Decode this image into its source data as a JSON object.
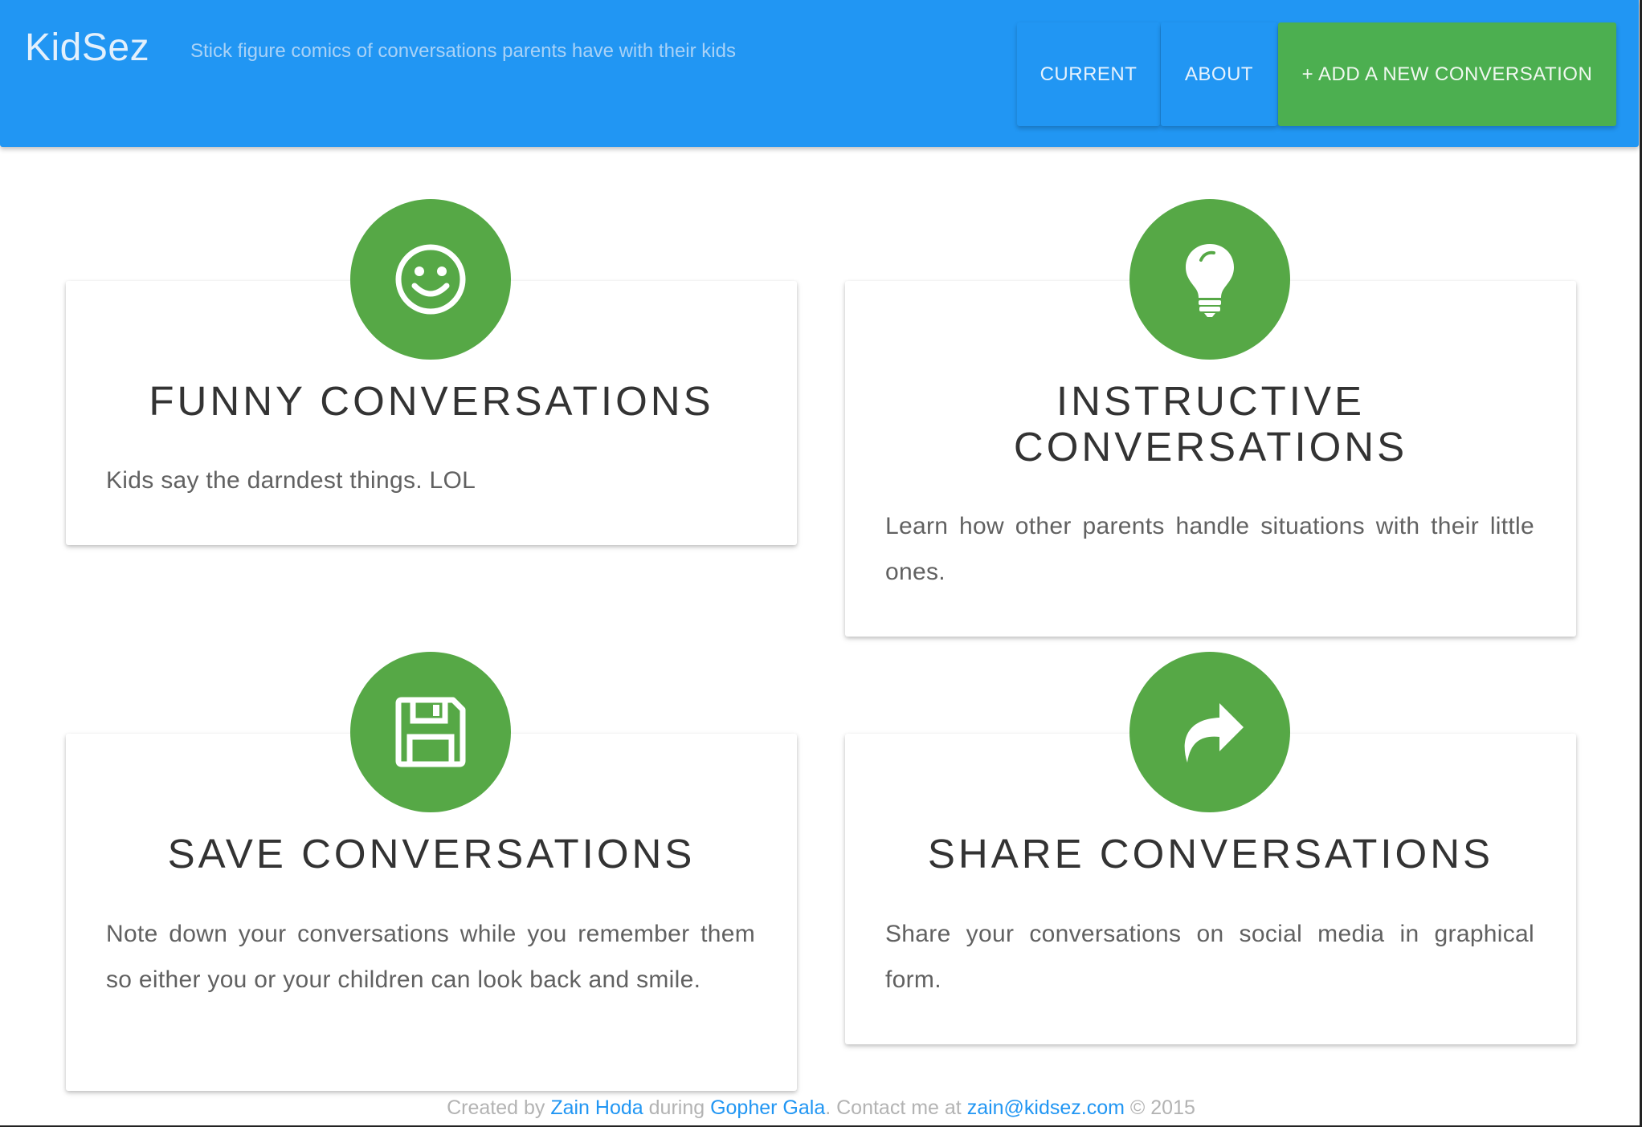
{
  "header": {
    "brand": "KidSez",
    "tagline": "Stick figure comics of conversations parents have with their kids",
    "nav": {
      "current": "CURRENT",
      "about": "ABOUT",
      "add": "+ ADD A NEW CONVERSATION"
    },
    "colors": {
      "primary": "#2196f3",
      "accent": "#4caf50"
    }
  },
  "features": [
    {
      "icon": "smiley-icon",
      "title": "FUNNY CONVERSATIONS",
      "text": "Kids say the darndest things. LOL"
    },
    {
      "icon": "lightbulb-icon",
      "title": "INSTRUCTIVE CONVERSATIONS",
      "text": "Learn how other parents handle situations with their little ones."
    },
    {
      "icon": "floppy-disk-icon",
      "title": "SAVE CONVERSATIONS",
      "text": "Note down your conversations while you remember them so either you or your children can look back and smile."
    },
    {
      "icon": "share-arrow-icon",
      "title": "SHARE CONVERSATIONS",
      "text": "Share your conversations on social media in graphical form."
    }
  ],
  "footer": {
    "created_by": "Created by ",
    "author": "Zain Hoda",
    "during": " during ",
    "event": "Gopher Gala",
    "contact": ". Contact me at ",
    "email": "zain@kidsez.com",
    "copyright": " © 2015"
  }
}
